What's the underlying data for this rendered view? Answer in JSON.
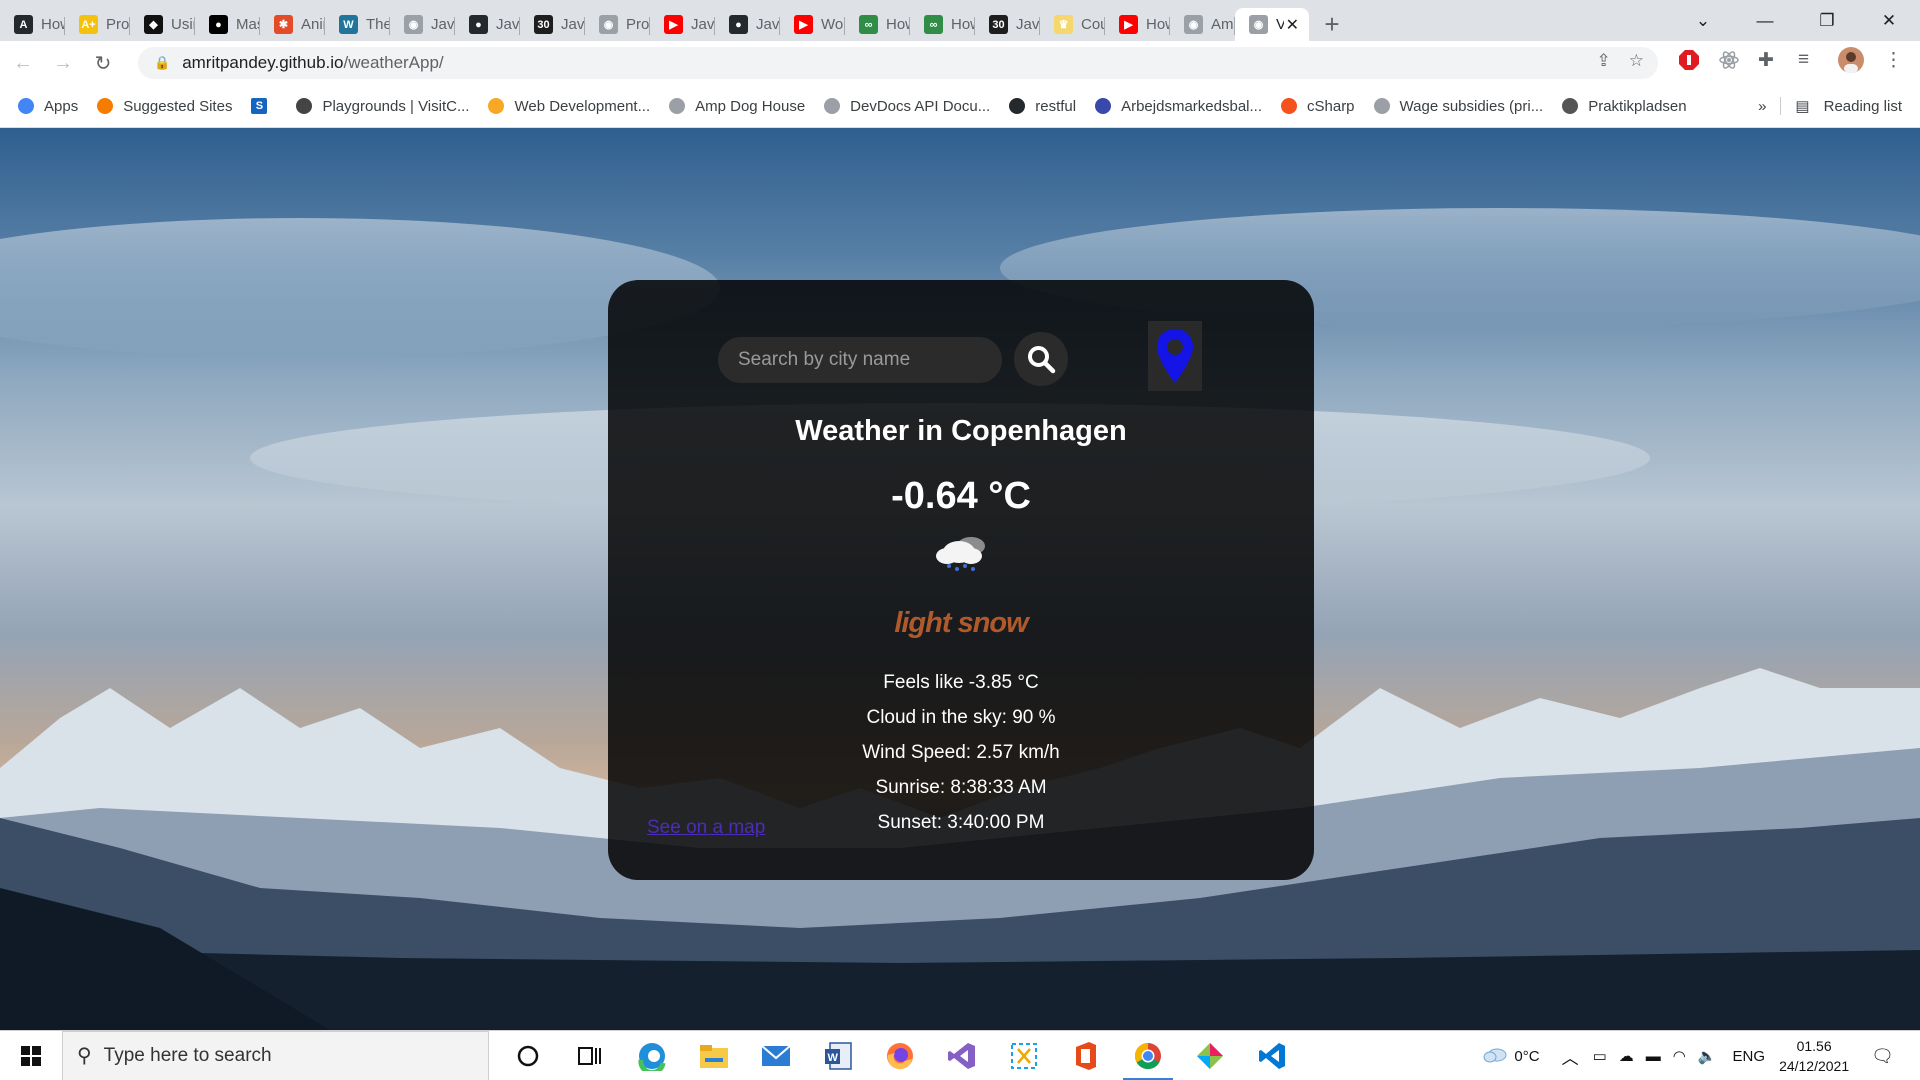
{
  "browser": {
    "tabs": [
      {
        "label": "How",
        "icon_color": "#24292e",
        "glyph": "A"
      },
      {
        "label": "Pror",
        "icon_color": "#f4c20d",
        "glyph": "A+"
      },
      {
        "label": "Usin",
        "icon_color": "#111111",
        "glyph": "◆"
      },
      {
        "label": "Mas",
        "icon_color": "#000000",
        "glyph": "●"
      },
      {
        "label": "Anin",
        "icon_color": "#e34c26",
        "glyph": "✱"
      },
      {
        "label": "The",
        "icon_color": "#21759b",
        "glyph": "W"
      },
      {
        "label": "Java",
        "icon_color": "#9aa0a6",
        "glyph": "◉"
      },
      {
        "label": "Java",
        "icon_color": "#24292e",
        "glyph": "●"
      },
      {
        "label": "Java",
        "icon_color": "#1e1e1e",
        "glyph": "30"
      },
      {
        "label": "Pror",
        "icon_color": "#9aa0a6",
        "glyph": "◉"
      },
      {
        "label": "Java",
        "icon_color": "#ff0000",
        "glyph": "▶"
      },
      {
        "label": "Java",
        "icon_color": "#24292e",
        "glyph": "●"
      },
      {
        "label": "Wor",
        "icon_color": "#ff0000",
        "glyph": "▶"
      },
      {
        "label": "How",
        "icon_color": "#2f8d46",
        "glyph": "∞"
      },
      {
        "label": "How",
        "icon_color": "#2f8d46",
        "glyph": "∞"
      },
      {
        "label": "Java",
        "icon_color": "#1e1e1e",
        "glyph": "30"
      },
      {
        "label": "Cou",
        "icon_color": "#f5d76e",
        "glyph": "♛"
      },
      {
        "label": "How",
        "icon_color": "#ff0000",
        "glyph": "▶"
      },
      {
        "label": "Am",
        "icon_color": "#9aa0a6",
        "glyph": "◉"
      },
      {
        "label": "V",
        "icon_color": "#9aa0a6",
        "glyph": "◉",
        "active": true
      }
    ],
    "new_tab": "+",
    "url_host": "amritpandey.github.io",
    "url_path": "/weatherApp/",
    "bookmarks": [
      {
        "label": "Apps",
        "color": "#4285f4"
      },
      {
        "label": "Suggested Sites",
        "color": "#f57c00"
      },
      {
        "label": "",
        "color": "#1565c0",
        "glyph": "S"
      },
      {
        "label": "Playgrounds | VisitC...",
        "color": "#444444"
      },
      {
        "label": "Web Development...",
        "color": "#f9a825"
      },
      {
        "label": "Amp Dog House",
        "color": "#9aa0a6"
      },
      {
        "label": "DevDocs API Docu...",
        "color": "#9aa0a6"
      },
      {
        "label": "restful",
        "color": "#24292e"
      },
      {
        "label": "Arbejdsmarkedsbal...",
        "color": "#3949ab"
      },
      {
        "label": "cSharp",
        "color": "#f4511e"
      },
      {
        "label": "Wage subsidies (pri...",
        "color": "#9aa0a6"
      },
      {
        "label": "Praktikpladsen",
        "color": "#555555"
      }
    ],
    "more_bookmarks": "»",
    "reading_list": "Reading list"
  },
  "weather": {
    "search_placeholder": "Search by city name",
    "title": "Weather in Copenhagen",
    "temperature": "-0.64 °C",
    "description": "light snow",
    "details": [
      "Feels like -3.85 °C",
      "Cloud in the sky: 90 %",
      "Wind Speed: 2.57 km/h",
      "Sunrise: 8:38:33 AM",
      "Sunset: 3:40:00 PM"
    ],
    "map_link": "See on a map",
    "pin_color": "#1414e6",
    "description_color": "#b05a2c",
    "link_color": "#4b2db8"
  },
  "taskbar": {
    "search_placeholder": "Type here to search",
    "weather_temp": "0°C",
    "language": "ENG",
    "time": "01.56",
    "date": "24/12/2021"
  }
}
